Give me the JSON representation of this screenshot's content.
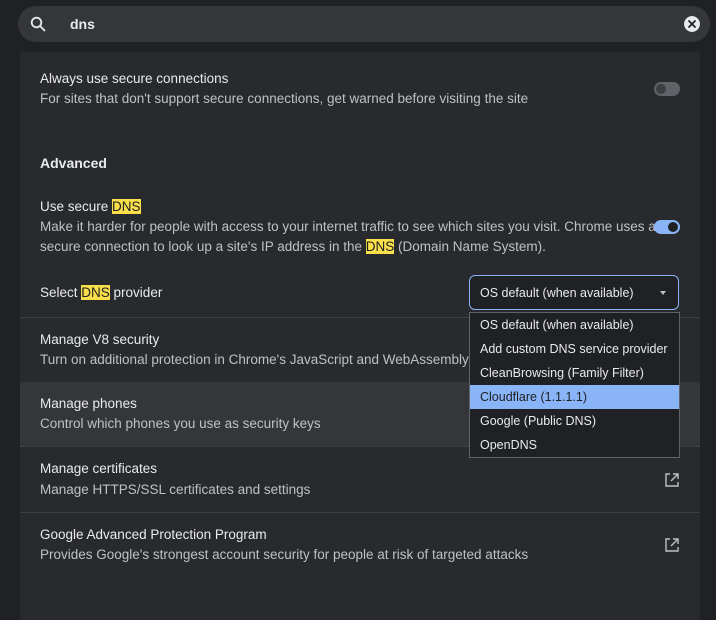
{
  "search": {
    "value": "dns"
  },
  "secure_connections": {
    "title": "Always use secure connections",
    "subtitle": "For sites that don't support secure connections, get warned before visiting the site",
    "enabled": false
  },
  "advanced": {
    "heading": "Advanced"
  },
  "secure_dns": {
    "title_prefix": "Use secure ",
    "title_hl": "DNS",
    "sub_line1": "Make it harder for people with access to your internet traffic to see which sites you visit. Chrome uses a",
    "sub_line2_prefix": "secure connection to look up a site's IP address in the ",
    "sub_line2_hl": "DNS",
    "sub_line2_suffix": " (Domain Name System).",
    "enabled": true
  },
  "dns_provider": {
    "label_prefix": "Select ",
    "label_hl": "DNS",
    "label_suffix": " provider",
    "selected": "OS default (when available)",
    "options": [
      "OS default (when available)",
      "Add custom DNS service provider",
      "CleanBrowsing (Family Filter)",
      "Cloudflare (1.1.1.1)",
      "Google (Public DNS)",
      "OpenDNS"
    ],
    "highlighted_option": "Cloudflare (1.1.1.1)"
  },
  "v8_security": {
    "title": "Manage V8 security",
    "subtitle": "Turn on additional protection in Chrome's JavaScript and WebAssembly eng"
  },
  "phones": {
    "title": "Manage phones",
    "subtitle": "Control which phones you use as security keys"
  },
  "certificates": {
    "title": "Manage certificates",
    "subtitle": "Manage HTTPS/SSL certificates and settings"
  },
  "advanced_protection": {
    "title": "Google Advanced Protection Program",
    "subtitle": "Provides Google's strongest account security for people at risk of targeted attacks"
  },
  "icons": {
    "search": "search-icon",
    "clear": "clear-icon",
    "external_link": "external-link-icon",
    "dropdown": "chevron-down-icon"
  },
  "colors": {
    "accent": "#8ab4f8",
    "highlight": "#f9e04b",
    "background": "#202124",
    "panel": "#292a2d"
  }
}
